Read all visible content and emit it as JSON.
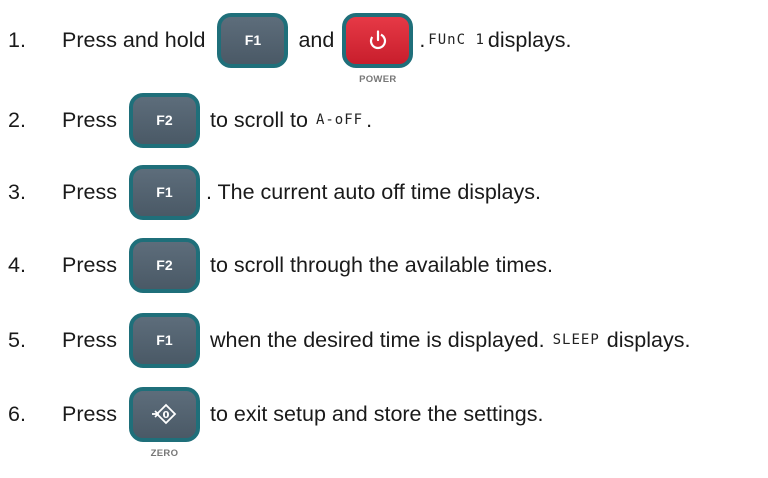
{
  "steps": [
    {
      "num": "1.",
      "parts": {
        "a": "Press and hold",
        "key1": "F1",
        "b": "and",
        "key2_label": "POWER",
        "c": ".",
        "lcd": "FUnC 1",
        "d": "displays."
      }
    },
    {
      "num": "2.",
      "parts": {
        "a": "Press",
        "key": "F2",
        "b": "to scroll to",
        "lcd": "A-oFF",
        "c": "."
      }
    },
    {
      "num": "3.",
      "parts": {
        "a": "Press",
        "key": "F1",
        "b": ". The current auto off time displays."
      }
    },
    {
      "num": "4.",
      "parts": {
        "a": "Press",
        "key": "F2",
        "b": "to scroll through the available times."
      }
    },
    {
      "num": "5.",
      "parts": {
        "a": "Press",
        "key": "F1",
        "b": "when the desired time is displayed.",
        "lcd": "SLEEP",
        "c": "displays."
      }
    },
    {
      "num": "6.",
      "parts": {
        "a": "Press",
        "key_label": "ZERO",
        "b": "to exit setup and store the settings."
      }
    }
  ],
  "icons": {
    "power": "power-icon",
    "zero": "zero-icon"
  },
  "colors": {
    "key_border": "#1f6f7a",
    "fkey_fill": "#55636f",
    "power_fill": "#d92b38"
  }
}
